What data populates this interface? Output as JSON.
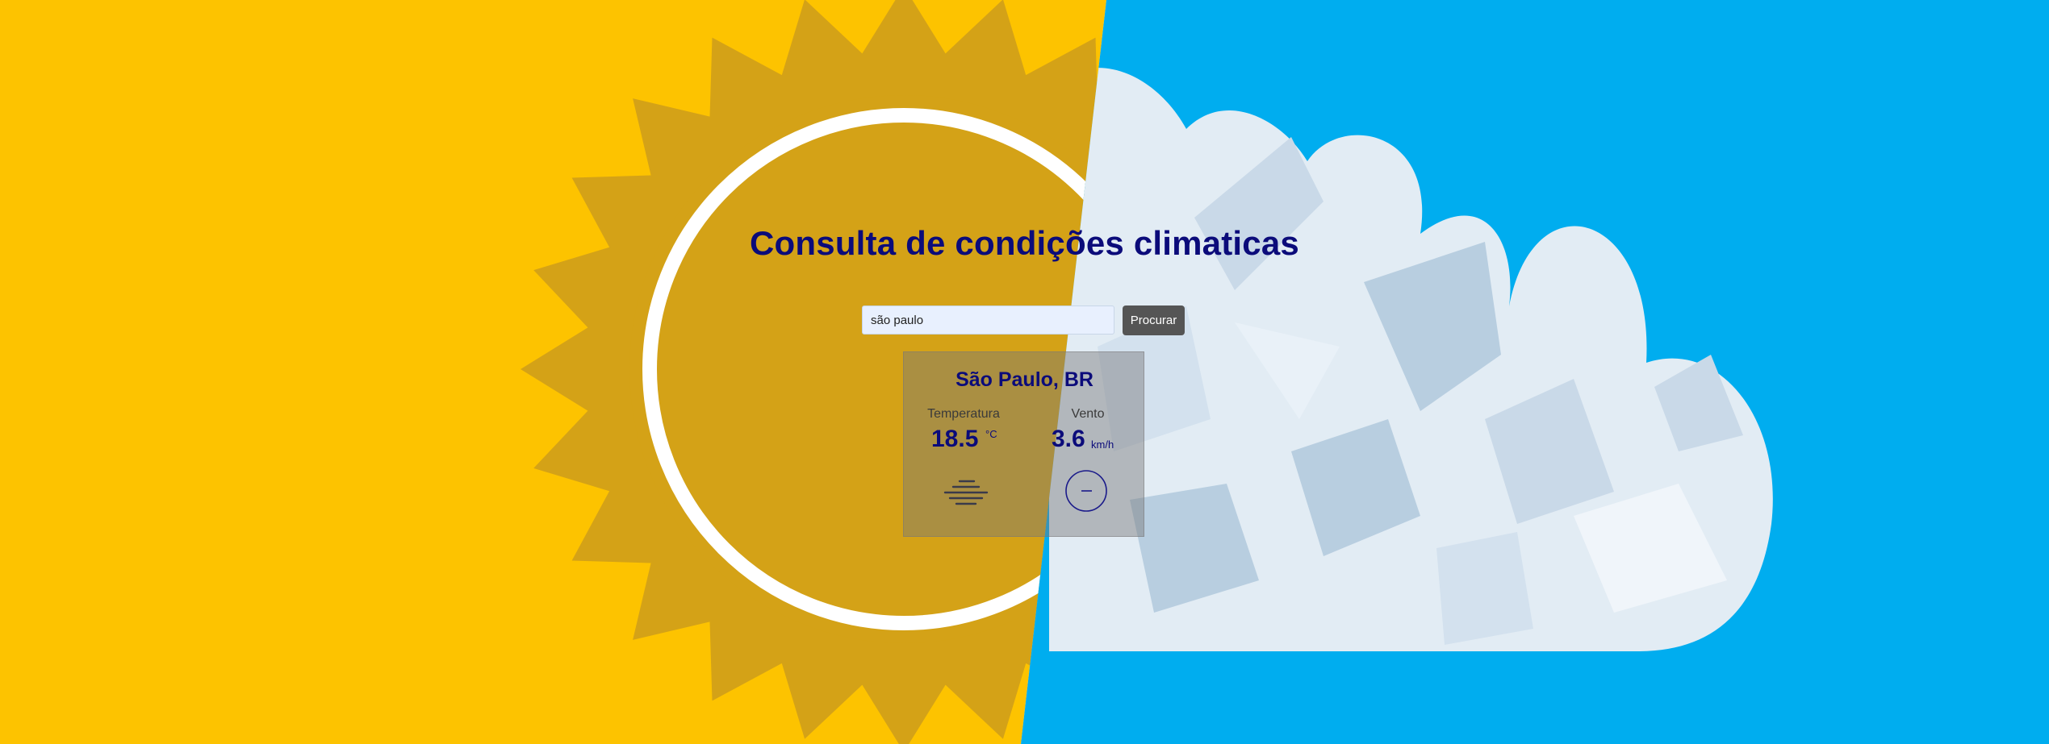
{
  "page": {
    "title": "Consulta de condições climaticas"
  },
  "search": {
    "value": "são paulo",
    "button_label": "Procurar"
  },
  "weather": {
    "city": "São Paulo, BR",
    "temperature_label": "Temperatura",
    "temperature_value": "18.5",
    "temperature_unit": "°C",
    "condition_icon": "fog-icon",
    "wind_label": "Vento",
    "wind_value": "3.6",
    "wind_unit": "km/h",
    "wind_icon": "wind-direction-icon"
  },
  "colors": {
    "sun_background": "#FDC300",
    "sun_body": "#D4A217",
    "sky_background": "#00ADEF",
    "cloud_light": "#E2ECF4",
    "cloud_mid": "#B8CEE0",
    "title_text": "#0B0B7A",
    "button_bg": "#555555"
  }
}
